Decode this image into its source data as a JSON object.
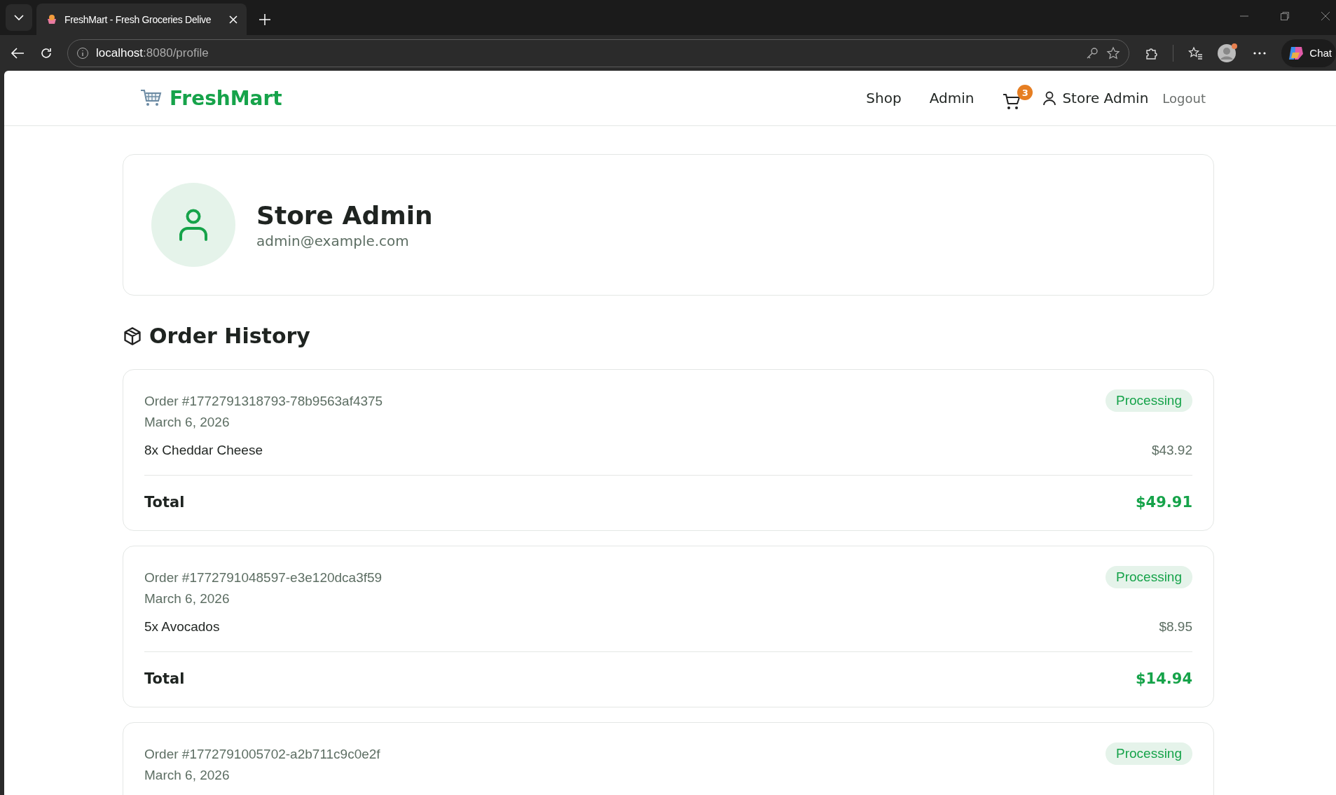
{
  "browser": {
    "tab_title": "FreshMart - Fresh Groceries Delive",
    "url_host": "localhost",
    "url_path": ":8080/profile",
    "chat_label": "Chat"
  },
  "header": {
    "logo": "FreshMart",
    "nav": [
      {
        "label": "Shop"
      },
      {
        "label": "Admin"
      }
    ],
    "cart_count": "3",
    "user_name": "Store Admin",
    "logout": "Logout"
  },
  "profile": {
    "name": "Store Admin",
    "email": "admin@example.com"
  },
  "orders_heading": "Order History",
  "orders": [
    {
      "id": "Order #1772791318793-78b9563af4375",
      "date": "March 6, 2026",
      "status": "Processing",
      "items": [
        {
          "name": "8x Cheddar Cheese",
          "price": "$43.92"
        }
      ],
      "total_label": "Total",
      "total": "$49.91"
    },
    {
      "id": "Order #1772791048597-e3e120dca3f59",
      "date": "March 6, 2026",
      "status": "Processing",
      "items": [
        {
          "name": "5x Avocados",
          "price": "$8.95"
        }
      ],
      "total_label": "Total",
      "total": "$14.94"
    },
    {
      "id": "Order #1772791005702-a2b711c9c0e2f",
      "date": "March 6, 2026",
      "status": "Processing"
    }
  ]
}
